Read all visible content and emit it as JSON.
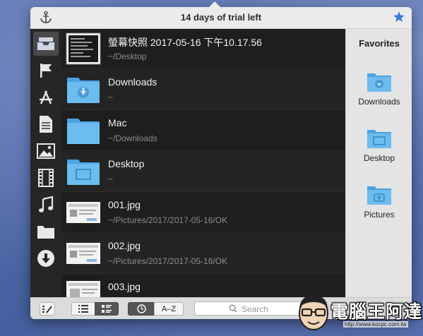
{
  "app": {
    "title": "14 days of trial left",
    "colors": {
      "folder": "#5fb4ec",
      "star": "#3a7ad9",
      "list_bg": "#1e1e1e",
      "sidebar_bg": "#262626"
    }
  },
  "sidebar": {
    "items": [
      {
        "icon": "inbox-tray-icon",
        "active": true
      },
      {
        "icon": "flag-icon"
      },
      {
        "icon": "app-store-icon"
      },
      {
        "icon": "document-icon"
      },
      {
        "icon": "image-icon"
      },
      {
        "icon": "film-icon"
      },
      {
        "icon": "music-note-icon"
      },
      {
        "icon": "folder-icon"
      },
      {
        "icon": "download-circle-icon"
      }
    ]
  },
  "files": [
    {
      "name": "螢幕快照 2017-05-16 下午10.17.56",
      "path": "~/Desktop",
      "kind": "screenshot"
    },
    {
      "name": "Downloads",
      "path": "~",
      "kind": "folder-downloads"
    },
    {
      "name": "Mac",
      "path": "~/Downloads",
      "kind": "folder"
    },
    {
      "name": "Desktop",
      "path": "~",
      "kind": "folder-desktop"
    },
    {
      "name": "001.jpg",
      "path": "~/Pictures/2017/2017-05-16/OK",
      "kind": "image"
    },
    {
      "name": "002.jpg",
      "path": "~/Pictures/2017/2017-05-16/OK",
      "kind": "image"
    },
    {
      "name": "003.jpg",
      "path": "",
      "kind": "image"
    }
  ],
  "favorites": {
    "title": "Favorites",
    "items": [
      {
        "label": "Downloads",
        "icon": "downloads-folder-icon"
      },
      {
        "label": "Desktop",
        "icon": "desktop-folder-icon"
      },
      {
        "label": "Pictures",
        "icon": "pictures-folder-icon"
      }
    ]
  },
  "toolbar": {
    "sort_az_label": "A–Z",
    "search_placeholder": "Search"
  },
  "watermark": {
    "text": "電腦王阿達",
    "url": "http://www.kocpc.com.tw"
  }
}
